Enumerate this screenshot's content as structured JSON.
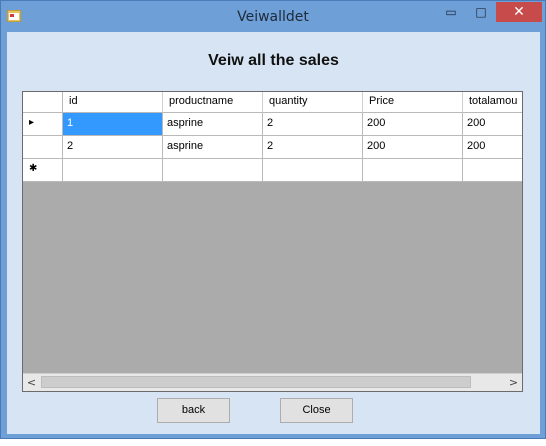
{
  "window": {
    "title": "Veiwalldet",
    "minimize_glyph": "▭",
    "maximize_glyph": "□",
    "close_glyph": "✕"
  },
  "heading": "Veiw all the sales",
  "grid": {
    "columns": [
      "id",
      "productname",
      "quantity",
      "Price",
      "totalamou"
    ],
    "rows": [
      {
        "marker": "▸",
        "cells": [
          "1",
          "asprine",
          "2",
          "200",
          "200"
        ]
      },
      {
        "marker": "",
        "cells": [
          "2",
          "asprine",
          "2",
          "200",
          "200"
        ]
      }
    ],
    "new_row_marker": "✱",
    "scroll_left": "<",
    "scroll_right": ">"
  },
  "buttons": {
    "back": "back",
    "close": "Close"
  }
}
